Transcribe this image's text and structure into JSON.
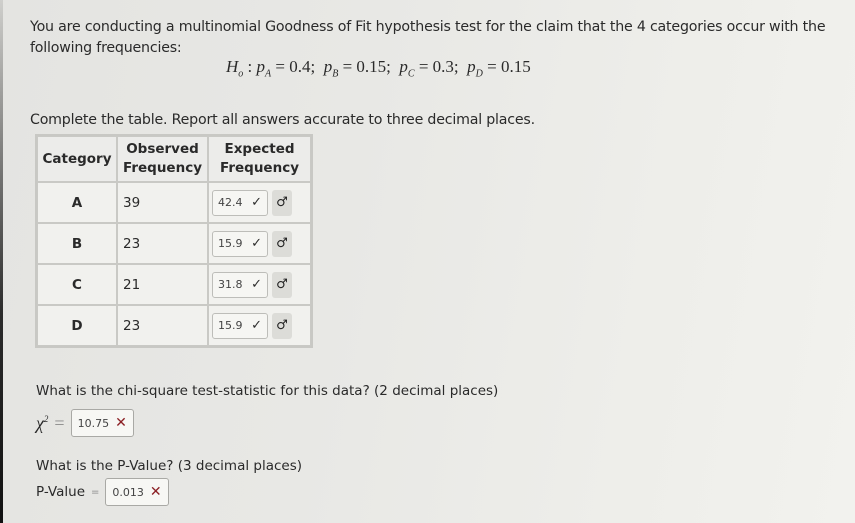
{
  "question": {
    "intro": "You are conducting a multinomial Goodness of Fit hypothesis test for the claim that the 4 categories occur with the following frequencies:",
    "hypothesis": {
      "label": "H",
      "sub": "o",
      "terms": [
        {
          "var": "p",
          "sub": "A",
          "value": "0.4"
        },
        {
          "var": "p",
          "sub": "B",
          "value": "0.15"
        },
        {
          "var": "p",
          "sub": "C",
          "value": "0.3"
        },
        {
          "var": "p",
          "sub": "D",
          "value": "0.15"
        }
      ]
    },
    "instruction": "Complete the table. Report all answers accurate to three decimal places."
  },
  "table": {
    "headers": {
      "category": "Category",
      "observed_line1": "Observed",
      "observed_line2": "Frequency",
      "expected_line1": "Expected",
      "expected_line2": "Frequency"
    },
    "rows": [
      {
        "category": "A",
        "observed": "39",
        "expected": "42.4",
        "status": "correct"
      },
      {
        "category": "B",
        "observed": "23",
        "expected": "15.9",
        "status": "correct"
      },
      {
        "category": "C",
        "observed": "21",
        "expected": "31.8",
        "status": "correct"
      },
      {
        "category": "D",
        "observed": "23",
        "expected": "15.9",
        "status": "correct"
      }
    ],
    "check_glyph": "✓",
    "icon_glyph": "♂"
  },
  "chi_square": {
    "prompt": "What is the chi-square test-statistic for this data? (2 decimal places)",
    "symbol": "χ",
    "power": "2",
    "equals": "=",
    "answer": "10.75",
    "status": "incorrect",
    "mark": "✕"
  },
  "p_value": {
    "prompt": "What is the P-Value? (3 decimal places)",
    "label": "P-Value",
    "equals": "=",
    "answer": "0.013",
    "status": "incorrect",
    "mark": "✕"
  },
  "colors": {
    "correct": "#2d2d2d",
    "incorrect": "#8b1f24"
  }
}
